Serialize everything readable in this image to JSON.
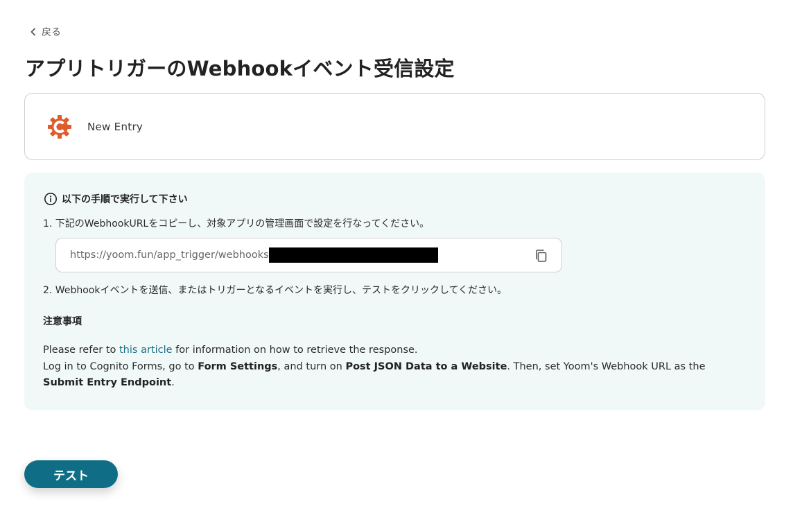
{
  "back": {
    "label": "戻る"
  },
  "page": {
    "title": "アプリトリガーのWebhookイベント受信設定"
  },
  "trigger": {
    "name": "New Entry",
    "icon": "cognito-forms-gear-icon",
    "icon_color": "#e05a2a"
  },
  "instructions": {
    "heading": "以下の手順で実行して下さい",
    "step1": "1. 下記のWebhookURLをコピーし、対象アプリの管理画面で設定を行なってください。",
    "url": "https://yoom.fun/app_trigger/webhooks",
    "step2": "2. Webhookイベントを送信、またはトリガーとなるイベントを実行し、テストをクリックしてください。"
  },
  "notes": {
    "title": "注意事項",
    "line1_pre": "Please refer to ",
    "line1_link": "this article",
    "line1_post": " for information on how to retrieve the response.",
    "line2_a": "Log in to Cognito Forms, go to ",
    "line2_b": "Form Settings",
    "line2_c": ", and turn on ",
    "line2_d": "Post JSON Data to a Website",
    "line2_e": ". Then, set Yoom's Webhook URL as the ",
    "line2_f": "Submit Entry Endpoint",
    "line2_g": "."
  },
  "actions": {
    "test_label": "テスト"
  },
  "colors": {
    "accent": "#0f6e85",
    "info_bg": "#f1f9f8",
    "link": "#1a6f86"
  }
}
